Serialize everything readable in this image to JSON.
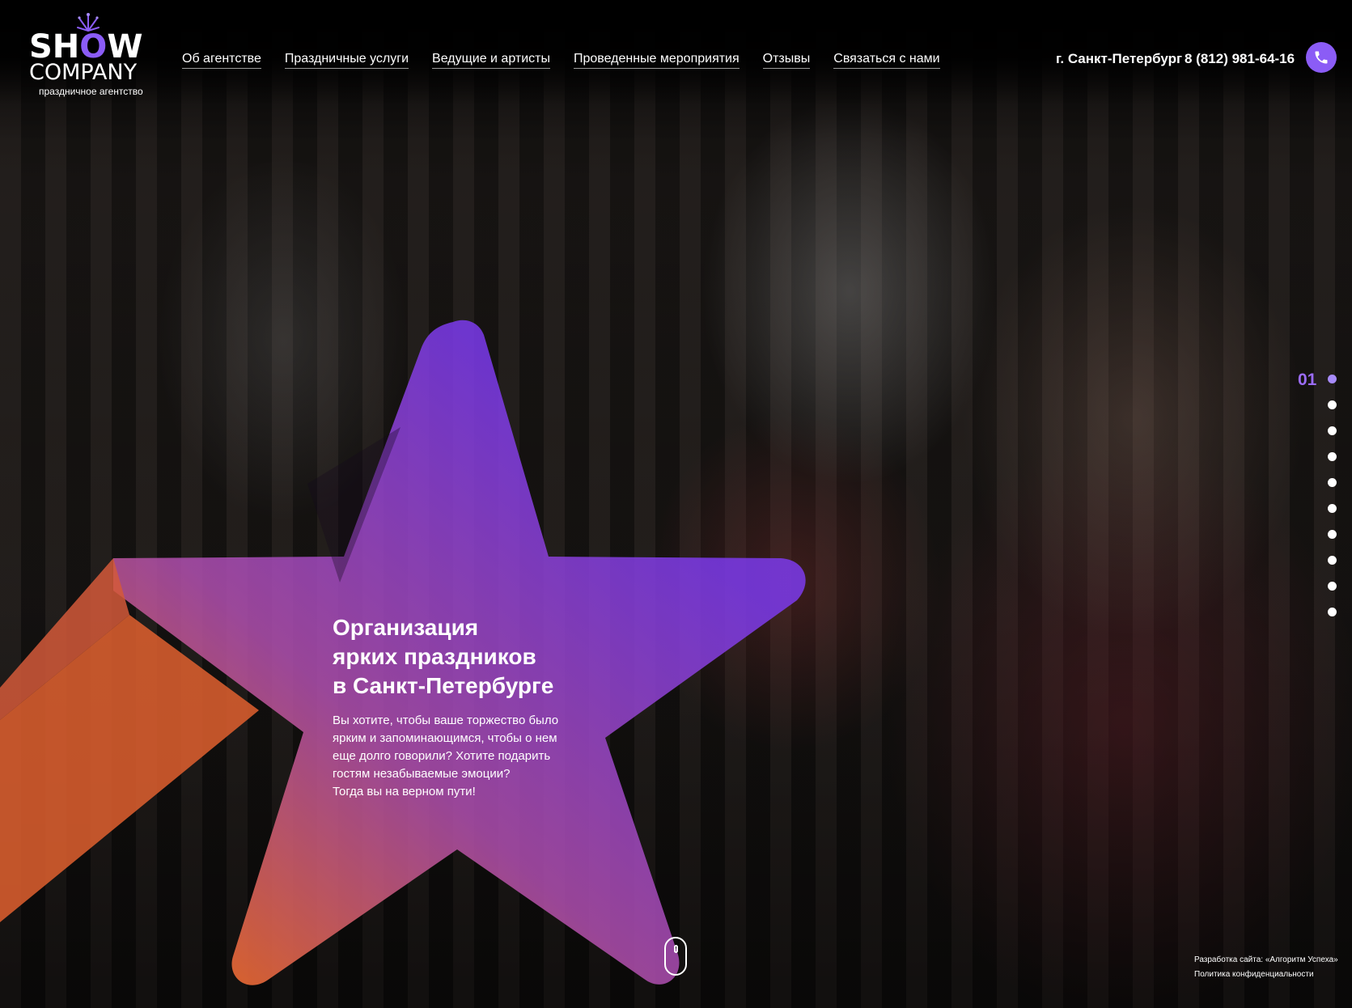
{
  "header": {
    "logo": {
      "word_top": "SHOW",
      "word_bottom": "COMPANY",
      "tagline": "праздничное агентство"
    },
    "nav": [
      {
        "label": "Об агентстве"
      },
      {
        "label": "Праздничные услуги"
      },
      {
        "label": "Ведущие и артисты"
      },
      {
        "label": "Проведенные мероприятия"
      },
      {
        "label": "Отзывы"
      },
      {
        "label": "Связаться с нами"
      }
    ],
    "city": "г. Санкт-Петербург",
    "phone": "8 (812) 981-64-16",
    "call_icon": "phone-icon"
  },
  "hero": {
    "title_lines": [
      "Организация",
      "ярких праздников",
      "в Санкт-Петербурге"
    ],
    "text_lines": [
      "Вы хотите, чтобы ваше торжество было",
      "ярким и запоминающимся, чтобы о нем",
      "еще долго говорили? Хотите подарить",
      "гостям незабываемые эмоции?",
      "Тогда вы на верном пути!"
    ]
  },
  "slider": {
    "current_number": "01",
    "dot_count": 10,
    "active_index": 0
  },
  "footer": {
    "developer": "Разработка сайта: «Алгоритм Успеха»",
    "privacy": "Политика конфиденциальности"
  },
  "colors": {
    "accent": "#8b5cf6",
    "star_top": "#7c3aed",
    "star_bottom": "#e8663a"
  }
}
